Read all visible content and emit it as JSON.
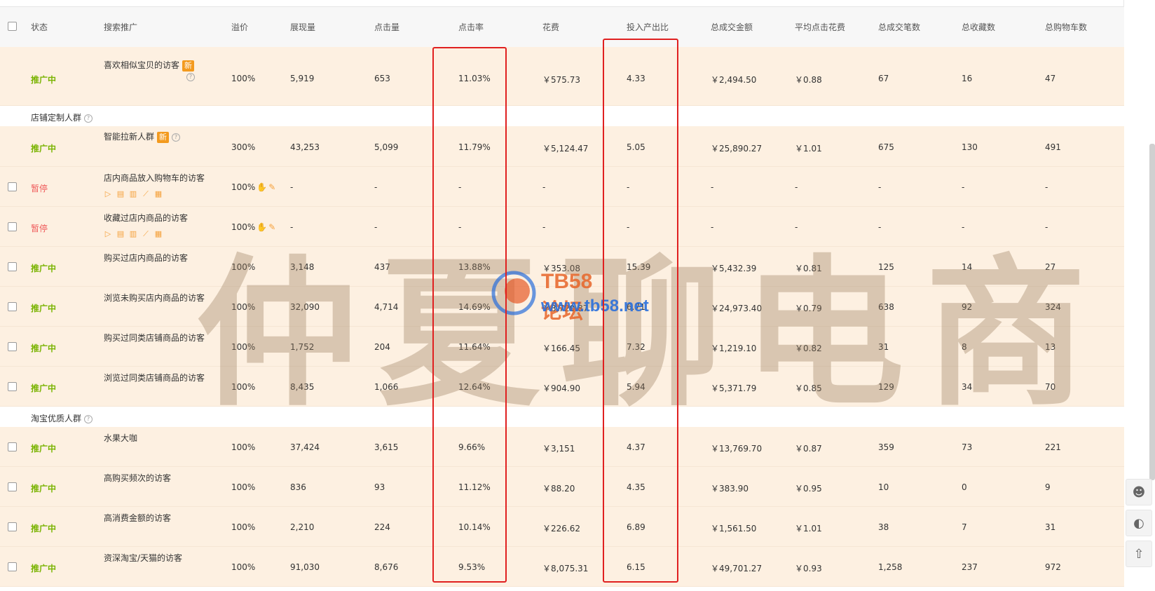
{
  "headers": {
    "status": "状态",
    "search": "搜索推广",
    "premium": "溢价",
    "impressions": "展现量",
    "clicks": "点击量",
    "ctr": "点击率",
    "cost": "花费",
    "roi": "投入产出比",
    "gmv": "总成交金额",
    "cpc": "平均点击花费",
    "orders": "总成交笔数",
    "favorites": "总收藏数",
    "carts": "总购物车数"
  },
  "badge_new": "新",
  "groups": [
    {
      "title": "店铺定制人群"
    },
    {
      "title": "淘宝优质人群"
    }
  ],
  "rows": [
    {
      "status": "推广中",
      "name": "喜欢相似宝贝的访客",
      "premium": "100%",
      "impressions": "5,919",
      "clicks": "653",
      "ctr": "11.03%",
      "cost": "￥575.73",
      "roi": "4.33",
      "gmv": "￥2,494.50",
      "cpc": "￥0.88",
      "orders": "67",
      "favorites": "16",
      "carts": "47"
    },
    {
      "status": "推广中",
      "name": "智能拉新人群",
      "premium": "300%",
      "impressions": "43,253",
      "clicks": "5,099",
      "ctr": "11.79%",
      "cost": "￥5,124.47",
      "roi": "5.05",
      "gmv": "￥25,890.27",
      "cpc": "￥1.01",
      "orders": "675",
      "favorites": "130",
      "carts": "491"
    },
    {
      "status": "暂停",
      "name": "店内商品放入购物车的访客",
      "premium": "100%",
      "impressions": "-",
      "clicks": "-",
      "ctr": "-",
      "cost": "-",
      "roi": "-",
      "gmv": "-",
      "cpc": "-",
      "orders": "-",
      "favorites": "-",
      "carts": "-"
    },
    {
      "status": "暂停",
      "name": "收藏过店内商品的访客",
      "premium": "100%",
      "impressions": "-",
      "clicks": "-",
      "ctr": "-",
      "cost": "-",
      "roi": "-",
      "gmv": "-",
      "cpc": "-",
      "orders": "-",
      "favorites": "-",
      "carts": "-"
    },
    {
      "status": "推广中",
      "name": "购买过店内商品的访客",
      "premium": "100%",
      "impressions": "3,148",
      "clicks": "437",
      "ctr": "13.88%",
      "cost": "￥353.08",
      "roi": "15.39",
      "gmv": "￥5,432.39",
      "cpc": "￥0.81",
      "orders": "125",
      "favorites": "14",
      "carts": "27"
    },
    {
      "status": "推广中",
      "name": "浏览未购买店内商品的访客",
      "premium": "100%",
      "impressions": "32,090",
      "clicks": "4,714",
      "ctr": "14.69%",
      "cost": "￥3,720.87",
      "roi": "6.71",
      "gmv": "￥24,973.40",
      "cpc": "￥0.79",
      "orders": "638",
      "favorites": "92",
      "carts": "324"
    },
    {
      "status": "推广中",
      "name": "购买过同类店铺商品的访客",
      "premium": "100%",
      "impressions": "1,752",
      "clicks": "204",
      "ctr": "11.64%",
      "cost": "￥166.45",
      "roi": "7.32",
      "gmv": "￥1,219.10",
      "cpc": "￥0.82",
      "orders": "31",
      "favorites": "8",
      "carts": "13"
    },
    {
      "status": "推广中",
      "name": "浏览过同类店铺商品的访客",
      "premium": "100%",
      "impressions": "8,435",
      "clicks": "1,066",
      "ctr": "12.64%",
      "cost": "￥904.90",
      "roi": "5.94",
      "gmv": "￥5,371.79",
      "cpc": "￥0.85",
      "orders": "129",
      "favorites": "34",
      "carts": "70"
    },
    {
      "status": "推广中",
      "name": "水果大咖",
      "premium": "100%",
      "impressions": "37,424",
      "clicks": "3,615",
      "ctr": "9.66%",
      "cost": "￥3,151",
      "roi": "4.37",
      "gmv": "￥13,769.70",
      "cpc": "￥0.87",
      "orders": "359",
      "favorites": "73",
      "carts": "221"
    },
    {
      "status": "推广中",
      "name": "高购买频次的访客",
      "premium": "100%",
      "impressions": "836",
      "clicks": "93",
      "ctr": "11.12%",
      "cost": "￥88.20",
      "roi": "4.35",
      "gmv": "￥383.90",
      "cpc": "￥0.95",
      "orders": "10",
      "favorites": "0",
      "carts": "9"
    },
    {
      "status": "推广中",
      "name": "高消费金额的访客",
      "premium": "100%",
      "impressions": "2,210",
      "clicks": "224",
      "ctr": "10.14%",
      "cost": "￥226.62",
      "roi": "6.89",
      "gmv": "￥1,561.50",
      "cpc": "￥1.01",
      "orders": "38",
      "favorites": "7",
      "carts": "31"
    },
    {
      "status": "推广中",
      "name": "资深淘宝/天猫的访客",
      "premium": "100%",
      "impressions": "91,030",
      "clicks": "8,676",
      "ctr": "9.53%",
      "cost": "￥8,075.31",
      "roi": "6.15",
      "gmv": "￥49,701.27",
      "cpc": "￥0.93",
      "orders": "1,258",
      "favorites": "237",
      "carts": "972"
    }
  ],
  "watermark": {
    "text": "仲夏聊电商",
    "forum_title": "TB58论坛",
    "forum_url": "www.tb58.net"
  },
  "colors": {
    "status_active": "#79b300",
    "status_paused": "#ef5a5a",
    "highlight_box": "#e02020",
    "row_bg": "#fdf0e1",
    "badge": "#f39a1e"
  },
  "icons": [
    "play-icon",
    "copy-icon",
    "delete-icon",
    "chart-icon",
    "report-icon",
    "hand-icon",
    "pencil-icon",
    "user-service-icon",
    "headset-icon",
    "back-to-top-icon"
  ]
}
